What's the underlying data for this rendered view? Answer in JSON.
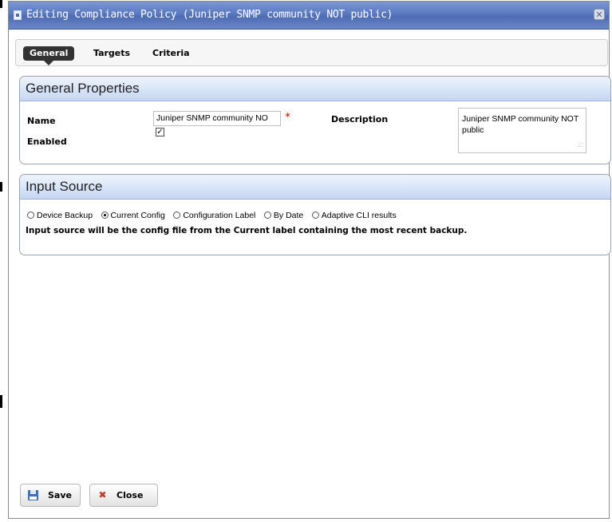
{
  "window": {
    "title": "Editing Compliance Policy (Juniper SNMP community NOT public)",
    "close_glyph": "✕"
  },
  "tabs": [
    {
      "label": "General",
      "active": true
    },
    {
      "label": "Targets",
      "active": false
    },
    {
      "label": "Criteria",
      "active": false
    }
  ],
  "general": {
    "heading": "General Properties",
    "name_label": "Name",
    "name_value": "Juniper SNMP community NO",
    "enabled_label": "Enabled",
    "enabled_checked": true,
    "enabled_glyph": "✓",
    "description_label": "Description",
    "description_value": "Juniper SNMP community NOT public"
  },
  "input_source": {
    "heading": "Input Source",
    "options": [
      {
        "label": "Device Backup",
        "selected": false
      },
      {
        "label": "Current Config",
        "selected": true
      },
      {
        "label": "Configuration Label",
        "selected": false
      },
      {
        "label": "By Date",
        "selected": false
      },
      {
        "label": "Adaptive CLI results",
        "selected": false
      }
    ],
    "info": "Input source will be the config file from the Current label containing the most recent backup."
  },
  "buttons": {
    "save_label": "Save",
    "close_label": "Close"
  },
  "icons": {
    "title": "document-icon",
    "required": "pin-icon",
    "save": "floppy-disk-icon",
    "close": "x-icon"
  },
  "colors": {
    "titlebar": "#5a79bf",
    "panel_header": "#c5d7f3",
    "active_tab": "#333333"
  }
}
